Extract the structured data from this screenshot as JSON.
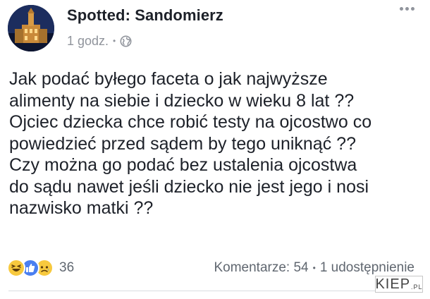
{
  "post": {
    "author": "Spotted: Sandomierz",
    "time": "1 godz.",
    "separator": "•",
    "privacy_icon": "globe-icon",
    "menu_icon": "more-options-icon",
    "body": "Jak podać byłego faceta o jak najwyższe\nalimenty na siebie i dziecko w wieku 8 lat ??\nOjciec dziecka chce robić testy na ojcostwo co\npowiedzieć przed sądem by tego uniknąć ??\nCzy można go podać bez ustalenia ojcostwa\ndo sądu nawet jeśli dziecko nie jest jego i nosi\nnazwisko matki ??"
  },
  "footer": {
    "reactions": [
      "haha-reaction-icon",
      "like-reaction-icon",
      "sad-reaction-icon"
    ],
    "reaction_count": "36",
    "comments": "Komentarze: 54",
    "separator": "•",
    "shares": "1 udostępnienie"
  },
  "watermark": {
    "text": "KIEP",
    "suffix": ".PL"
  },
  "colors": {
    "text": "#1d2129",
    "meta": "#90949c",
    "like_blue": "#4a7ff0",
    "emoji_yellow": "#f7c93e"
  }
}
